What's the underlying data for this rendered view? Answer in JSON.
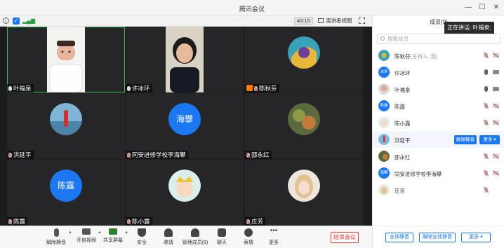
{
  "window": {
    "title": "腾讯会议",
    "colors": {
      "accent": "#1b78f2",
      "end": "#e53935",
      "active_border": "#3fbf5a",
      "host": "#f57c00"
    }
  },
  "infobar": {
    "timer": "43:15",
    "speaker_view": "演讲者视图"
  },
  "tiles": [
    {
      "name": "叶福泉",
      "mic": "on",
      "video": "on",
      "active": true
    },
    {
      "name": "许冰环",
      "mic": "on",
      "video": "on"
    },
    {
      "name": "陈秋芬",
      "mic": "muted",
      "host": true,
      "avatar": "image"
    },
    {
      "name": "洪延平",
      "mic": "muted",
      "avatar": "image"
    },
    {
      "name": "同安进修学校李海攀",
      "mic": "muted",
      "avatar_text": "海攀"
    },
    {
      "name": "邵永红",
      "mic": "muted",
      "avatar": "image"
    },
    {
      "name": "陈露",
      "mic": "muted",
      "avatar_text": "陈露"
    },
    {
      "name": "陈小露",
      "mic": "muted",
      "avatar": "image"
    },
    {
      "name": "庄芳",
      "mic": "muted",
      "avatar": "image"
    }
  ],
  "toolbar": {
    "items": [
      {
        "label": "解除静音",
        "icon": "mic-muted-icon"
      },
      {
        "label": "开启视频",
        "icon": "camera-off-icon"
      },
      {
        "label": "共享屏幕",
        "icon": "share-screen-icon"
      },
      {
        "label": "安全",
        "icon": "shield-icon"
      },
      {
        "label": "邀请",
        "icon": "invite-icon"
      },
      {
        "label": "管理成员(9)",
        "icon": "members-icon"
      },
      {
        "label": "聊天",
        "icon": "chat-icon"
      },
      {
        "label": "表情",
        "icon": "emoji-icon"
      },
      {
        "label": "更多",
        "icon": "more-icon"
      }
    ],
    "end_label": "结束会议"
  },
  "members_panel": {
    "title": "成员(9)",
    "speaking_label": "正在讲话: 叶福泉;",
    "search_placeholder": "搜索成员",
    "members": [
      {
        "name": "陈秋芬",
        "sub": "(主持人, 我)",
        "mic": "muted",
        "camera": "off",
        "avatar": "image"
      },
      {
        "name": "许冰环",
        "mic": "on",
        "camera": "on",
        "avatar_text": "冰环",
        "avatar_color": "#1b78f2"
      },
      {
        "name": "叶福泉",
        "mic": "on",
        "camera": "on",
        "avatar": "image"
      },
      {
        "name": "陈露",
        "mic": "muted",
        "camera": "off",
        "avatar_text": "陈露",
        "avatar_color": "#1b78f2"
      },
      {
        "name": "陈小露",
        "mic": "muted",
        "camera": "off",
        "avatar": "image"
      },
      {
        "name": "洪延平",
        "hover": true,
        "unmute_label": "解除静音",
        "more_label": "更多"
      },
      {
        "name": "邵永红",
        "mic": "muted",
        "camera": "off",
        "avatar": "image"
      },
      {
        "name": "同安进修学校李海攀",
        "mic": "muted",
        "camera": "off",
        "avatar_text": "海攀",
        "avatar_color": "#1b78f2"
      },
      {
        "name": "庄芳",
        "mic": "muted",
        "avatar": "image"
      }
    ],
    "footer": {
      "mute_all": "全体静音",
      "unmute_all": "解除全体静音",
      "more": "更多"
    }
  }
}
